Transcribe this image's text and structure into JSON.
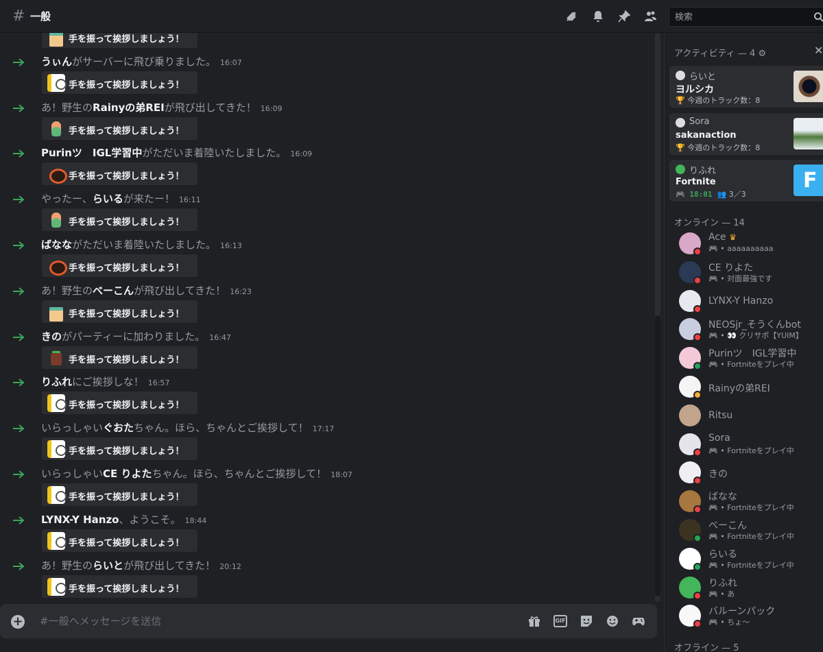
{
  "header": {
    "channel_name": "一般",
    "search_placeholder": "検索"
  },
  "messages": [
    {
      "pre": "",
      "name": "",
      "post": "",
      "time": "",
      "sticker": "box"
    },
    {
      "pre": "",
      "name": "うぃん",
      "post": "がサーバーに飛び乗りました。",
      "time": "16:07",
      "sticker": "dog"
    },
    {
      "pre": "あ！野生の",
      "name": "Rainyの弟REI",
      "post": "が飛び出してきた！",
      "time": "16:09",
      "sticker": "bird"
    },
    {
      "pre": "",
      "name": "Purinツ　IGL学習中",
      "post": "がただいま着陸いたしました。",
      "time": "16:09",
      "sticker": "bot"
    },
    {
      "pre": "やったー、",
      "name": "らいる",
      "post": "が来たー！",
      "time": "16:11",
      "sticker": "bird"
    },
    {
      "pre": "",
      "name": "ばなな",
      "post": "がただいま着陸いたしました。",
      "time": "16:13",
      "sticker": "bot"
    },
    {
      "pre": "あ！野生の",
      "name": "べーこん",
      "post": "が飛び出してきた！",
      "time": "16:23",
      "sticker": "box"
    },
    {
      "pre": "",
      "name": "きの",
      "post": "がパーティーに加わりました。",
      "time": "16:47",
      "sticker": "sup"
    },
    {
      "pre": "",
      "name": "りふれ",
      "post": "にご挨拶しな！",
      "time": "16:57",
      "sticker": "dog"
    },
    {
      "pre": "いらっしゃい",
      "name": "ぐおた",
      "post": "ちゃん。ほら、ちゃんとご挨拶して！",
      "time": "17:17",
      "sticker": "dog"
    },
    {
      "pre": "いらっしゃい",
      "name": "CE りよた",
      "post": "ちゃん。ほら、ちゃんとご挨拶して！",
      "time": "18:07",
      "sticker": "dog"
    },
    {
      "pre": "",
      "name": "LYNX-Y Hanzo",
      "post": "、ようこそ。",
      "time": "18:44",
      "sticker": "dog"
    },
    {
      "pre": "あ！野生の",
      "name": "らいと",
      "post": "が飛び出してきた！",
      "time": "20:12",
      "sticker": "dog"
    }
  ],
  "wave_label": "手を振って挨拶しましょう！",
  "composer": {
    "placeholder": "#一般へメッセージを送信",
    "gif_label": "GIF"
  },
  "activity": {
    "title": "アクティビティ — 4",
    "cards": [
      {
        "user": "らいと",
        "title": "ヨルシカ",
        "meta": "🏆 今週のトラック数：8",
        "thumb": "eye"
      },
      {
        "user": "Sora",
        "title": "sakanaction",
        "meta": "🏆 今週のトラック数：8",
        "thumb": "island"
      },
      {
        "user": "りふれ",
        "title": "Fortnite",
        "time": "18:01",
        "party": "3／3",
        "thumb": "fortnite"
      }
    ]
  },
  "online_title": "オンライン — 14",
  "offline_title": "オフライン — 5",
  "members": [
    {
      "name": "Ace",
      "activity": "aaaaaaaaaa",
      "status": "dnd",
      "crown": true,
      "color": "#d9a7c7"
    },
    {
      "name": "CE りよた",
      "activity": "対面最強です",
      "status": "dnd",
      "color": "#2a3a55"
    },
    {
      "name": "LYNX-Y Hanzo",
      "activity": "",
      "status": "dnd",
      "color": "#e6e9f0"
    },
    {
      "name": "NEOSjr_そうくんbot",
      "activity": "👀 クリサポ【YUIM】",
      "status": "dnd",
      "color": "#c8cde0"
    },
    {
      "name": "Purinツ　IGL学習中",
      "activity": "Fortniteをプレイ中",
      "status": "online",
      "color": "#f3c9d8"
    },
    {
      "name": "Rainyの弟REI",
      "activity": "",
      "status": "idle",
      "color": "#f5f5f5"
    },
    {
      "name": "Ritsu",
      "activity": "",
      "status": "none",
      "color": "#c2a48c"
    },
    {
      "name": "Sora",
      "activity": "Fortniteをプレイ中",
      "status": "dnd",
      "color": "#e4e4ea"
    },
    {
      "name": "きの",
      "activity": "",
      "status": "dnd",
      "color": "#efeff3"
    },
    {
      "name": "ばなな",
      "activity": "Fortniteをプレイ中",
      "status": "dnd",
      "color": "#a8773f"
    },
    {
      "name": "べーこん",
      "activity": "Fortniteをプレイ中",
      "status": "online",
      "color": "#3b3320"
    },
    {
      "name": "らいる",
      "activity": "Fortniteをプレイ中",
      "status": "mobile",
      "color": "#ffffff"
    },
    {
      "name": "りふれ",
      "activity": "あ",
      "status": "dnd",
      "color": "#43b55b"
    },
    {
      "name": "バルーンパック",
      "activity": "ちょ〜",
      "status": "dnd",
      "color": "#f8f8f8"
    }
  ]
}
